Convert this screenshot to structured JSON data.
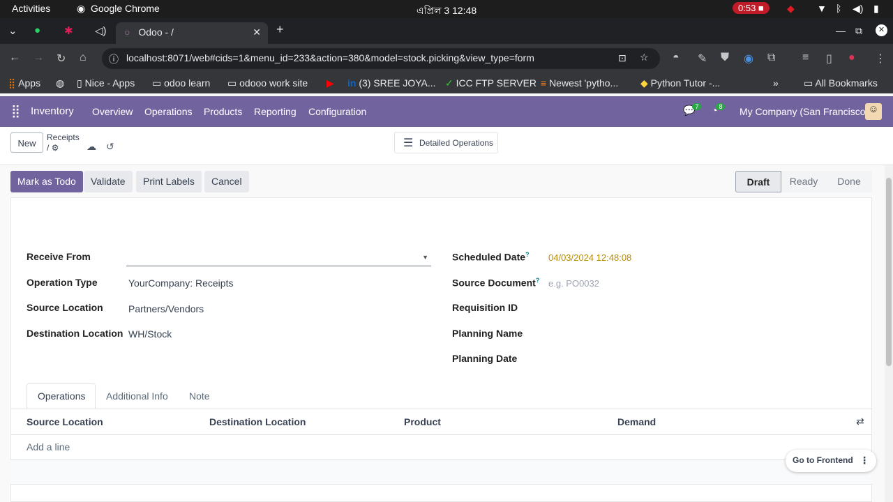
{
  "os": {
    "activities": "Activities",
    "app_name": "Google Chrome",
    "clock": "এপ্রিল 3  12:48",
    "recording": "0:53"
  },
  "browser": {
    "tab_title": "Odoo - /",
    "url": "localhost:8071/web#cids=1&menu_id=233&action=380&model=stock.picking&view_type=form",
    "bookmarks": [
      "Apps",
      "Nice - Apps",
      "odoo learn",
      "odooo work site",
      "(3) SREE JOYA...",
      "ICC FTP SERVER",
      "Newest 'pytho...",
      "Python Tutor -...",
      "All Bookmarks"
    ]
  },
  "navbar": {
    "app": "Inventory",
    "menus": [
      "Overview",
      "Operations",
      "Products",
      "Reporting",
      "Configuration"
    ],
    "chat_count": "7",
    "activity_count": "8",
    "company": "My Company (San Francisco)"
  },
  "control": {
    "new_label": "New",
    "breadcrumb": "Receipts",
    "breadcrumb_sep": "/",
    "detailed_ops": "Detailed Operations"
  },
  "actions": {
    "mark_todo": "Mark as Todo",
    "validate": "Validate",
    "print_labels": "Print Labels",
    "cancel": "Cancel"
  },
  "statusbar": [
    "Draft",
    "Ready",
    "Done"
  ],
  "form": {
    "receive_from_label": "Receive From",
    "operation_type_label": "Operation Type",
    "operation_type_value": "YourCompany: Receipts",
    "source_location_label": "Source Location",
    "source_location_value": "Partners/Vendors",
    "dest_location_label": "Destination Location",
    "dest_location_value": "WH/Stock",
    "scheduled_date_label": "Scheduled Date",
    "scheduled_date_value": "04/03/2024 12:48:08",
    "source_document_label": "Source Document",
    "source_document_placeholder": "e.g. PO0032",
    "requisition_label": "Requisition ID",
    "planning_name_label": "Planning Name",
    "planning_date_label": "Planning Date",
    "help_mark": "?"
  },
  "notebook": {
    "tabs": [
      "Operations",
      "Additional Info",
      "Note"
    ],
    "columns": [
      "Source Location",
      "Destination Location",
      "Product",
      "Demand"
    ],
    "add_line": "Add a line"
  },
  "floating": {
    "go_frontend": "Go to Frontend"
  },
  "colors": {
    "brand": "#71639e",
    "date_warning": "#b88b00"
  }
}
